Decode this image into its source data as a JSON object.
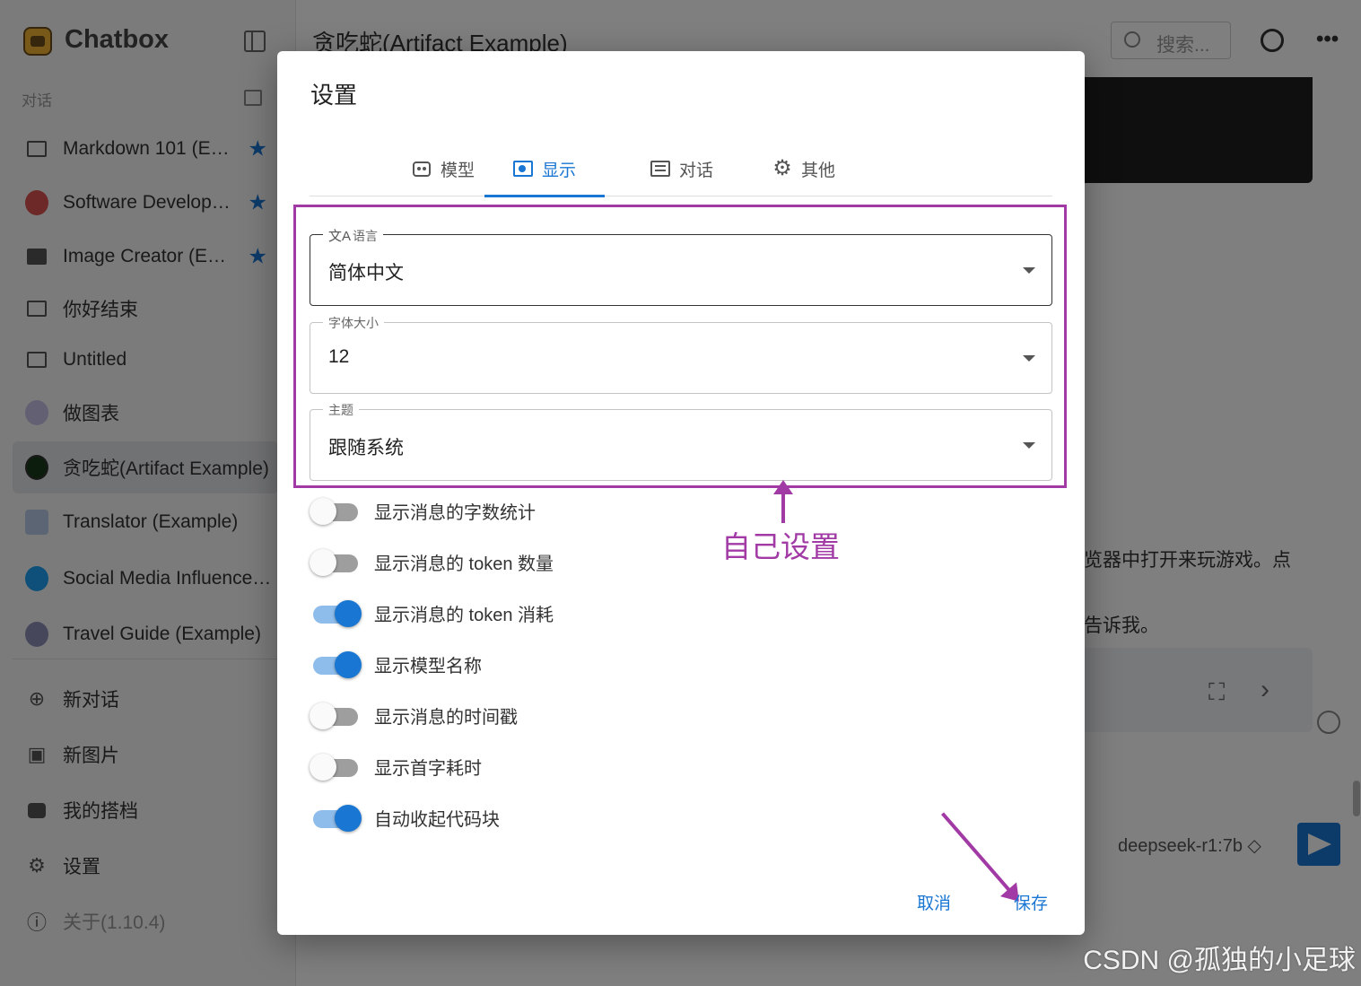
{
  "sidebar": {
    "app_title": "Chatbox",
    "section_label": "对话",
    "conversations": [
      {
        "label": "Markdown 101 (E…",
        "starred": true
      },
      {
        "label": "Software Develop…",
        "starred": true
      },
      {
        "label": "Image Creator (E…",
        "starred": true
      },
      {
        "label": "你好结束",
        "starred": false
      },
      {
        "label": "Untitled",
        "starred": false
      },
      {
        "label": "做图表",
        "starred": false
      },
      {
        "label": "贪吃蛇(Artifact Example)",
        "starred": false,
        "active": true
      },
      {
        "label": "Translator (Example)",
        "starred": false
      },
      {
        "label": "Social Media Influence…",
        "starred": false
      },
      {
        "label": "Travel Guide (Example)",
        "starred": false
      }
    ],
    "nav": [
      {
        "label": "新对话",
        "icon": "plus-circle-icon"
      },
      {
        "label": "新图片",
        "icon": "add-image-icon"
      },
      {
        "label": "我的搭档",
        "icon": "robot-icon"
      },
      {
        "label": "设置",
        "icon": "gear-icon"
      },
      {
        "label": "关于(1.10.4)",
        "icon": "info-icon"
      }
    ]
  },
  "main": {
    "title": "贪吃蛇(Artifact Example)",
    "search_placeholder": "搜索...",
    "bg_text_1": "览器中打开来玩游戏。点",
    "bg_text_2": "告诉我。",
    "model_label": "deepseek-r1:7b ◇"
  },
  "dialog": {
    "title": "设置",
    "tabs": [
      {
        "label": "模型",
        "active": false
      },
      {
        "label": "显示",
        "active": true
      },
      {
        "label": "对话",
        "active": false
      },
      {
        "label": "其他",
        "active": false
      }
    ],
    "fields": [
      {
        "label": "语言",
        "value": "简体中文"
      },
      {
        "label": "字体大小",
        "value": "12"
      },
      {
        "label": "主题",
        "value": "跟随系统"
      }
    ],
    "switches": [
      {
        "label": "显示消息的字数统计",
        "on": false
      },
      {
        "label": "显示消息的 token 数量",
        "on": false
      },
      {
        "label": "显示消息的 token 消耗",
        "on": true
      },
      {
        "label": "显示模型名称",
        "on": true
      },
      {
        "label": "显示消息的时间戳",
        "on": false
      },
      {
        "label": "显示首字耗时",
        "on": false
      },
      {
        "label": "自动收起代码块",
        "on": true
      }
    ],
    "cancel_label": "取消",
    "save_label": "保存"
  },
  "annotation": {
    "text": "自己设置",
    "color": "#a23aa5"
  },
  "watermark": "CSDN @孤独的小足球",
  "colors": {
    "accent": "#1976d2",
    "annotation": "#a23aa5"
  }
}
